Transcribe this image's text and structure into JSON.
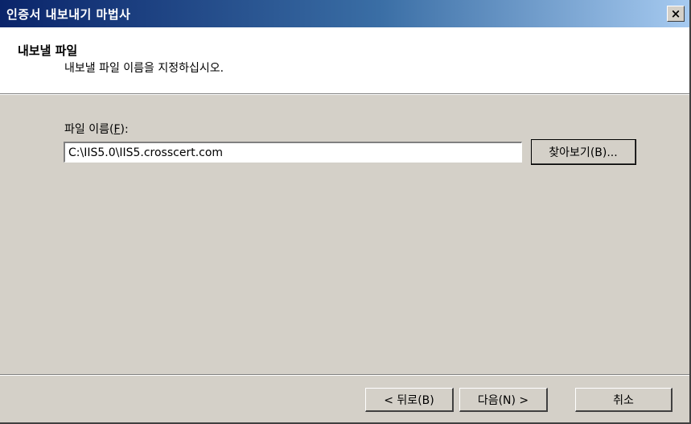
{
  "window": {
    "title": "인증서 내보내기 마법사",
    "close_glyph": "×",
    "close_icon": "close-icon"
  },
  "header": {
    "title": "내보낼 파일",
    "description": "내보낼 파일 이름을 지정하십시오."
  },
  "form": {
    "file_label_prefix": "파일 이름(",
    "file_label_key": "F",
    "file_label_suffix": "):",
    "file_value": "C:\\IIS5.0\\IIS5.crosscert.com",
    "browse_label": "찾아보기(B)..."
  },
  "footer": {
    "back_label": "< 뒤로(B)",
    "next_label": "다음(N) >",
    "cancel_label": "취소"
  }
}
